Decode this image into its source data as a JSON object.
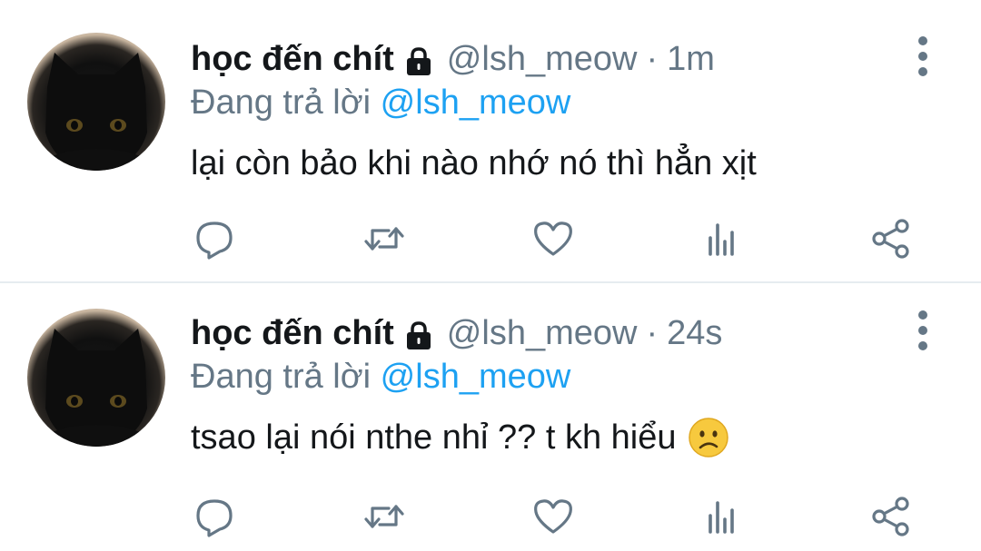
{
  "colors": {
    "text_primary": "#14171a",
    "text_secondary": "#657786",
    "link": "#1da1f2",
    "divider": "#e6ecf0"
  },
  "tweets": [
    {
      "display_name": "học đến chít",
      "handle": "@lsh_meow",
      "separator": "·",
      "time": "1m",
      "replying_prefix": "Đang trả lời",
      "replying_to": "@lsh_meow",
      "text": "lại còn bảo khi nào nhớ nó thì hẳn xịt",
      "emoji": null,
      "icons": [
        "lock-icon",
        "more-vertical-icon",
        "reply-icon",
        "retweet-icon",
        "like-icon",
        "stats-icon",
        "share-icon"
      ]
    },
    {
      "display_name": "học đến chít",
      "handle": "@lsh_meow",
      "separator": "·",
      "time": "24s",
      "replying_prefix": "Đang trả lời",
      "replying_to": "@lsh_meow",
      "text": "tsao lại nói nthe nhỉ ?? t kh hiểu",
      "emoji": "slightly-frowning-face",
      "icons": [
        "lock-icon",
        "more-vertical-icon",
        "reply-icon",
        "retweet-icon",
        "like-icon",
        "stats-icon",
        "share-icon"
      ]
    }
  ]
}
